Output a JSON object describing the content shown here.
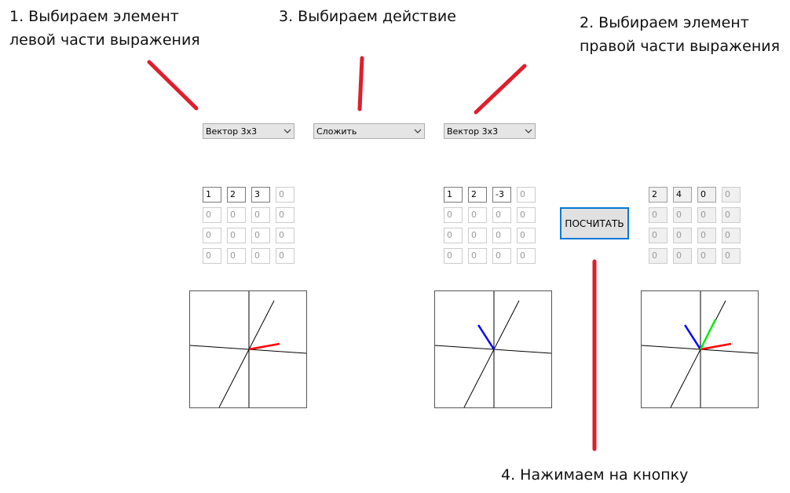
{
  "annotations": {
    "step1": [
      "1. Выбираем элемент",
      "левой части выражения"
    ],
    "step2": [
      "2. Выбираем элемент",
      "правой части выражения"
    ],
    "step3": "3. Выбираем действие",
    "step4": "4. Нажимаем на кнопку",
    "marker_color": "#e01e2b"
  },
  "controls": {
    "left_type": "Вектор 3x3",
    "operation": "Сложить",
    "right_type": "Вектор 3x3",
    "calculate_label": "ПОСЧИТАТЬ"
  },
  "matrices": {
    "left": [
      [
        "1",
        "2",
        "3",
        "0"
      ],
      [
        "0",
        "0",
        "0",
        "0"
      ],
      [
        "0",
        "0",
        "0",
        "0"
      ],
      [
        "0",
        "0",
        "0",
        "0"
      ]
    ],
    "right": [
      [
        "1",
        "2",
        "-3",
        "0"
      ],
      [
        "0",
        "0",
        "0",
        "0"
      ],
      [
        "0",
        "0",
        "0",
        "0"
      ],
      [
        "0",
        "0",
        "0",
        "0"
      ]
    ],
    "result": [
      [
        "2",
        "4",
        "0",
        "0"
      ],
      [
        "0",
        "0",
        "0",
        "0"
      ],
      [
        "0",
        "0",
        "0",
        "0"
      ],
      [
        "0",
        "0",
        "0",
        "0"
      ]
    ]
  },
  "plots": {
    "left": {
      "vectors": [
        [
          1,
          2,
          3
        ]
      ],
      "colors": [
        "#ff0000"
      ]
    },
    "right": {
      "vectors": [
        [
          1,
          2,
          -3
        ]
      ],
      "colors": [
        "#0000ff"
      ]
    },
    "result": {
      "vectors": [
        [
          1,
          2,
          3
        ],
        [
          1,
          2,
          -3
        ],
        [
          2,
          4,
          0
        ]
      ],
      "colors": [
        "#ff0000",
        "#0000ff",
        "#00ee00"
      ]
    }
  },
  "icons": {
    "dropdown": "chevron-down-icon"
  }
}
